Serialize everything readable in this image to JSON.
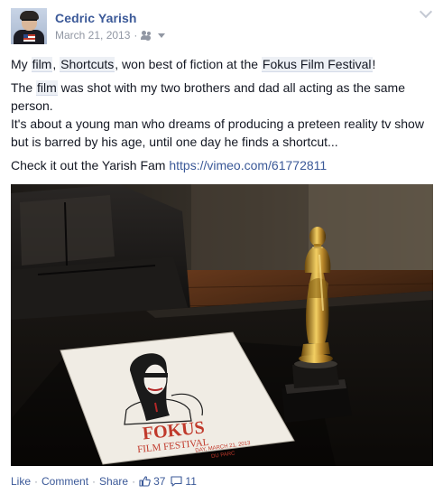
{
  "post": {
    "author": "Cedric Yarish",
    "date": "March 21, 2013",
    "meta_separator": "·",
    "audience_icon": "friends-icon",
    "text": {
      "line1_prefix": "My ",
      "tag_film": "film",
      "comma1": ", ",
      "tag_shortcuts": "Shortcuts",
      "line1_mid": ", won best of fiction at the ",
      "tag_festival": "Fokus Film Festival",
      "line1_end": "!",
      "line2_prefix": "The ",
      "tag_film2": "film",
      "line2_rest": " was shot with my two brothers and dad all acting as the same person.",
      "line3": "It's about a young man who dreams of producing a preteen reality tv show but is barred by his age, until one day he finds a shortcut...",
      "line4_prefix": "Check it out the Yarish Fam ",
      "line4_link": "https://vimeo.com/61772811"
    },
    "photo": {
      "booklet_title": "FOKUS",
      "booklet_subtitle": "FILM FESTIVAL",
      "booklet_date": "DAY, MARCH 21, 2013",
      "booklet_venue": "DU PARC"
    },
    "actions": {
      "like": "Like",
      "comment": "Comment",
      "share": "Share",
      "separator": "·",
      "likes_count": "37",
      "comments_count": "11"
    },
    "colors": {
      "link": "#3b5998",
      "meta": "#9197a3",
      "text": "#141823",
      "tag_bg": "#edf0f5"
    }
  }
}
